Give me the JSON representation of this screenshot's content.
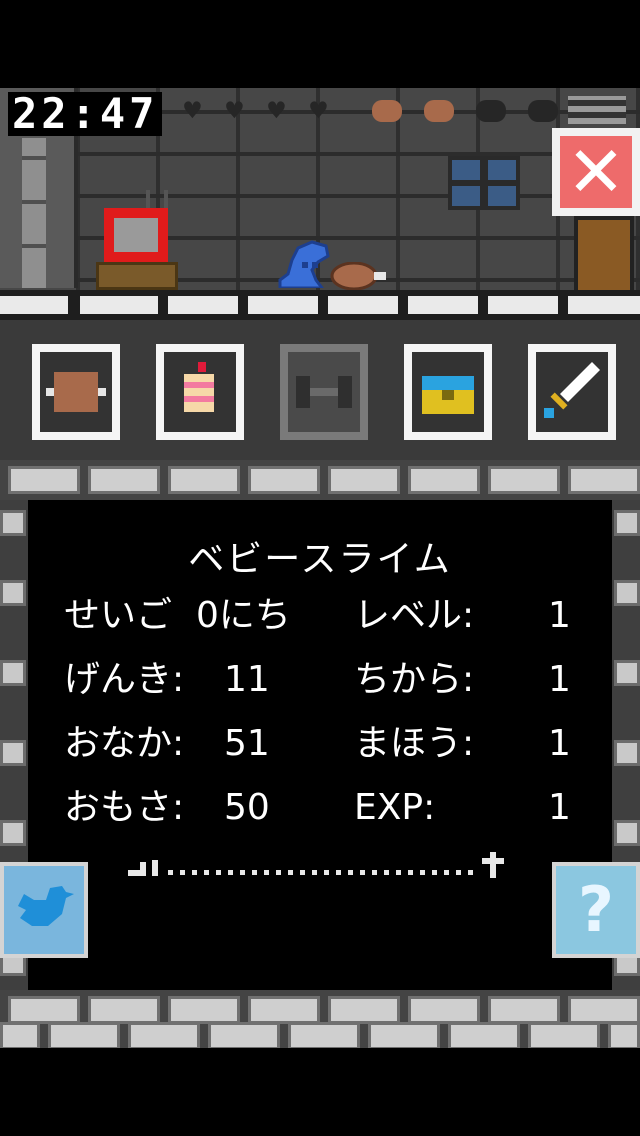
{
  "clock": "22:47",
  "hearts_total": 4,
  "meat_full": 2,
  "meat_total": 4,
  "close_label": "✕",
  "status": {
    "name": "ベビースライム",
    "rows": [
      {
        "left_label": "せいご",
        "left_value": "0にち",
        "right_label": "レベル:",
        "right_value": "1"
      },
      {
        "left_label": "げんき:",
        "left_value": "11",
        "right_label": "ちから:",
        "right_value": "1"
      },
      {
        "left_label": "おなか:",
        "left_value": "51",
        "right_label": "まほう:",
        "right_value": "1"
      },
      {
        "left_label": "おもさ:",
        "left_value": "50",
        "right_label": "EXP:",
        "right_value": "1"
      }
    ],
    "evolution_progress": 0.0
  },
  "items": [
    {
      "name": "meat",
      "icon": "meat-icon",
      "enabled": true
    },
    {
      "name": "cake",
      "icon": "cake-icon",
      "enabled": true
    },
    {
      "name": "dumbbell",
      "icon": "dumbbell-icon",
      "enabled": false
    },
    {
      "name": "treasure",
      "icon": "treasure-chest-icon",
      "enabled": true
    },
    {
      "name": "sword",
      "icon": "sword-icon",
      "enabled": true
    }
  ],
  "help_label": "?",
  "colors": {
    "close_red": "#ee6b6b",
    "slime_blue": "#3a6fd8",
    "meat_brown": "#a86a4b",
    "twitter_blue": "#2b9be0"
  }
}
